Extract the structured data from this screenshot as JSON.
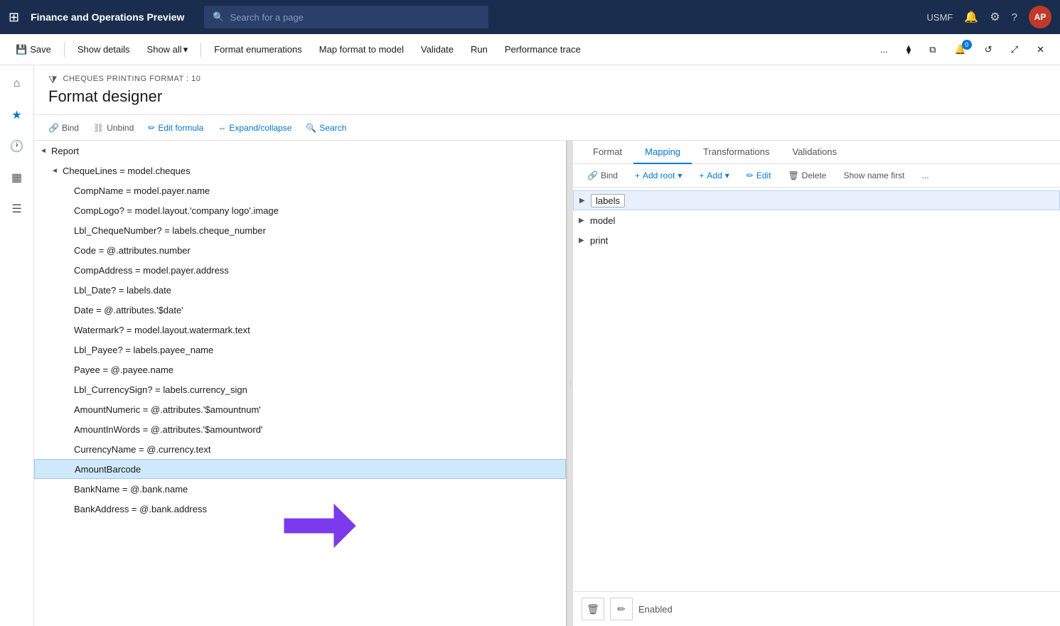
{
  "app": {
    "title": "Finance and Operations Preview",
    "search_placeholder": "Search for a page",
    "user_initials": "AP",
    "region": "USMF"
  },
  "toolbar": {
    "save_label": "Save",
    "show_details_label": "Show details",
    "show_all_label": "Show all",
    "format_enumerations_label": "Format enumerations",
    "map_format_label": "Map format to model",
    "validate_label": "Validate",
    "run_label": "Run",
    "performance_trace_label": "Performance trace"
  },
  "page": {
    "breadcrumb": "CHEQUES PRINTING FORMAT : 10",
    "title": "Format designer"
  },
  "sub_toolbar": {
    "bind_label": "Bind",
    "unbind_label": "Unbind",
    "edit_formula_label": "Edit formula",
    "expand_collapse_label": "Expand/collapse",
    "search_label": "Search"
  },
  "tree": {
    "items": [
      {
        "id": 1,
        "indent": 0,
        "chevron": "◄",
        "text": "Report"
      },
      {
        "id": 2,
        "indent": 1,
        "chevron": "◄",
        "text": "ChequeLines = model.cheques"
      },
      {
        "id": 3,
        "indent": 2,
        "chevron": "",
        "text": "CompName = model.payer.name"
      },
      {
        "id": 4,
        "indent": 2,
        "chevron": "",
        "text": "CompLogo? = model.layout.'company logo'.image"
      },
      {
        "id": 5,
        "indent": 2,
        "chevron": "",
        "text": "Lbl_ChequeNumber? = labels.cheque_number"
      },
      {
        "id": 6,
        "indent": 2,
        "chevron": "",
        "text": "Code = @.attributes.number"
      },
      {
        "id": 7,
        "indent": 2,
        "chevron": "",
        "text": "CompAddress = model.payer.address"
      },
      {
        "id": 8,
        "indent": 2,
        "chevron": "",
        "text": "Lbl_Date? = labels.date"
      },
      {
        "id": 9,
        "indent": 2,
        "chevron": "",
        "text": "Date = @.attributes.'$date'"
      },
      {
        "id": 10,
        "indent": 2,
        "chevron": "",
        "text": "Watermark? = model.layout.watermark.text"
      },
      {
        "id": 11,
        "indent": 2,
        "chevron": "",
        "text": "Lbl_Payee? = labels.payee_name"
      },
      {
        "id": 12,
        "indent": 2,
        "chevron": "",
        "text": "Payee = @.payee.name"
      },
      {
        "id": 13,
        "indent": 2,
        "chevron": "",
        "text": "Lbl_CurrencySign? = labels.currency_sign"
      },
      {
        "id": 14,
        "indent": 2,
        "chevron": "",
        "text": "AmountNumeric = @.attributes.'$amountnum'"
      },
      {
        "id": 15,
        "indent": 2,
        "chevron": "",
        "text": "AmountInWords = @.attributes.'$amountword'"
      },
      {
        "id": 16,
        "indent": 2,
        "chevron": "",
        "text": "CurrencyName = @.currency.text"
      },
      {
        "id": 17,
        "indent": 2,
        "chevron": "",
        "text": "AmountBarcode",
        "selected": true
      },
      {
        "id": 18,
        "indent": 2,
        "chevron": "",
        "text": "BankName = @.bank.name"
      },
      {
        "id": 19,
        "indent": 2,
        "chevron": "",
        "text": "BankAddress = @.bank.address"
      }
    ]
  },
  "mapping": {
    "tabs": [
      {
        "id": "format",
        "label": "Format"
      },
      {
        "id": "mapping",
        "label": "Mapping",
        "active": true
      },
      {
        "id": "transformations",
        "label": "Transformations"
      },
      {
        "id": "validations",
        "label": "Validations"
      }
    ],
    "toolbar": {
      "bind_label": "Bind",
      "add_root_label": "Add root",
      "add_label": "Add",
      "edit_label": "Edit",
      "delete_label": "Delete",
      "show_name_first_label": "Show name first"
    },
    "tree_items": [
      {
        "id": "labels",
        "label": "labels",
        "selected": true,
        "indent": 0,
        "arrow": "▶"
      },
      {
        "id": "model",
        "label": "model",
        "selected": false,
        "indent": 0,
        "arrow": "▶"
      },
      {
        "id": "print",
        "label": "print",
        "selected": false,
        "indent": 0,
        "arrow": "▶"
      }
    ],
    "bottom": {
      "delete_icon": "🗑",
      "edit_icon": "✏",
      "status_label": "Enabled"
    }
  },
  "icons": {
    "grid": "⊞",
    "search": "🔍",
    "bell": "🔔",
    "settings": "⚙",
    "help": "?",
    "home": "⌂",
    "star": "★",
    "clock": "🕐",
    "calendar": "▦",
    "list": "☰",
    "filter": "⧩",
    "chevron_down": "▾",
    "chevron_right": "▶",
    "link": "🔗",
    "unlink": "⛓",
    "formula": "f",
    "expand": "⇔",
    "magnify": "🔍",
    "splitter": "⋮",
    "trash": "🗑",
    "pencil": "✏",
    "more": "...",
    "refresh": "↺",
    "expand_window": "⤢",
    "close": "✕",
    "puzzle": "⧫",
    "layers": "⧉"
  }
}
